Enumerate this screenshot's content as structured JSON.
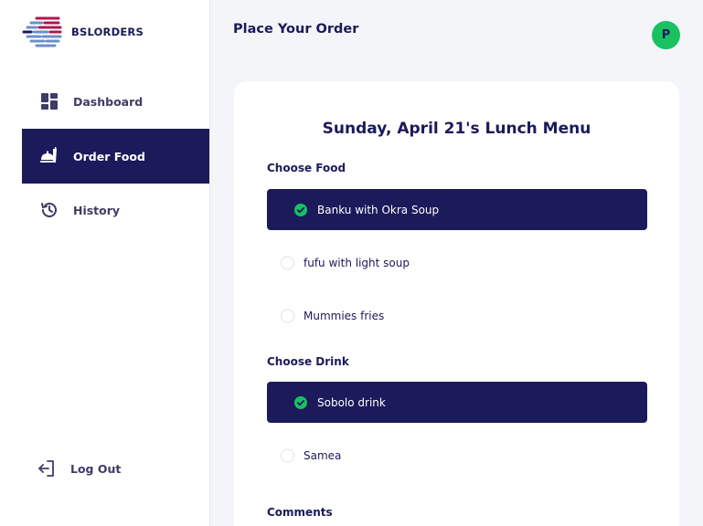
{
  "brand": {
    "name": "BSLORDERS"
  },
  "sidebar": {
    "items": [
      {
        "label": "Dashboard",
        "icon": "dashboard-icon"
      },
      {
        "label": "Order Food",
        "icon": "food-tray-icon",
        "active": true
      },
      {
        "label": "History",
        "icon": "history-icon"
      }
    ],
    "logout": {
      "label": "Log Out",
      "icon": "logout-icon"
    }
  },
  "header": {
    "title": "Place Your Order",
    "avatar_initial": "P"
  },
  "menu": {
    "title": "Sunday, April 21's Lunch Menu",
    "food_label": "Choose Food",
    "food_options": [
      {
        "label": "Banku with Okra Soup",
        "selected": true
      },
      {
        "label": "fufu with light soup",
        "selected": false
      },
      {
        "label": "Mummies fries",
        "selected": false
      }
    ],
    "drink_label": "Choose Drink",
    "drink_options": [
      {
        "label": "Sobolo drink",
        "selected": true
      },
      {
        "label": "Samea",
        "selected": false
      }
    ],
    "comments_label": "Comments"
  },
  "colors": {
    "primary": "#1b1a5b",
    "accent_green": "#19c160",
    "background": "#f4f5f9"
  }
}
